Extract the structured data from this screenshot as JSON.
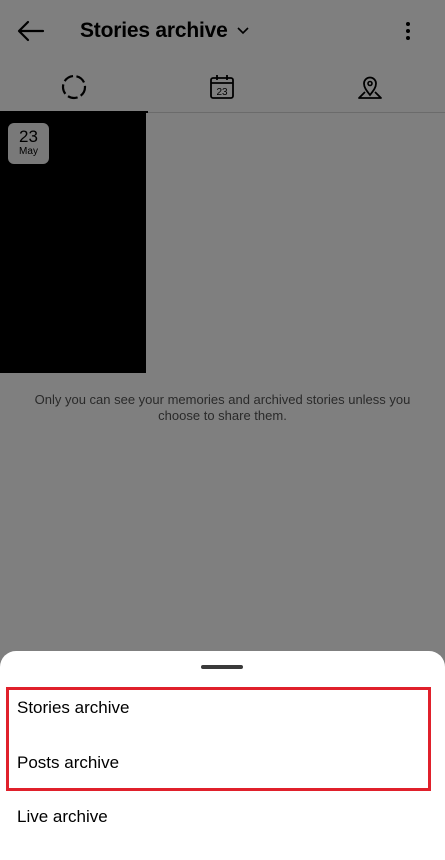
{
  "header": {
    "title": "Stories archive"
  },
  "tabs": [
    {
      "name": "stories",
      "icon": "dashed-circle-icon"
    },
    {
      "name": "calendar",
      "icon": "calendar-icon",
      "badge": "23"
    },
    {
      "name": "map",
      "icon": "map-pin-icon"
    }
  ],
  "tile": {
    "day": "23",
    "month": "May"
  },
  "info_text": "Only you can see your memories and archived stories unless you choose to share them.",
  "sheet": {
    "items": [
      "Stories archive",
      "Posts archive",
      "Live archive"
    ]
  },
  "colors": {
    "highlight": "#e0202b",
    "scrim": "rgba(0,0,0,0.5)"
  }
}
